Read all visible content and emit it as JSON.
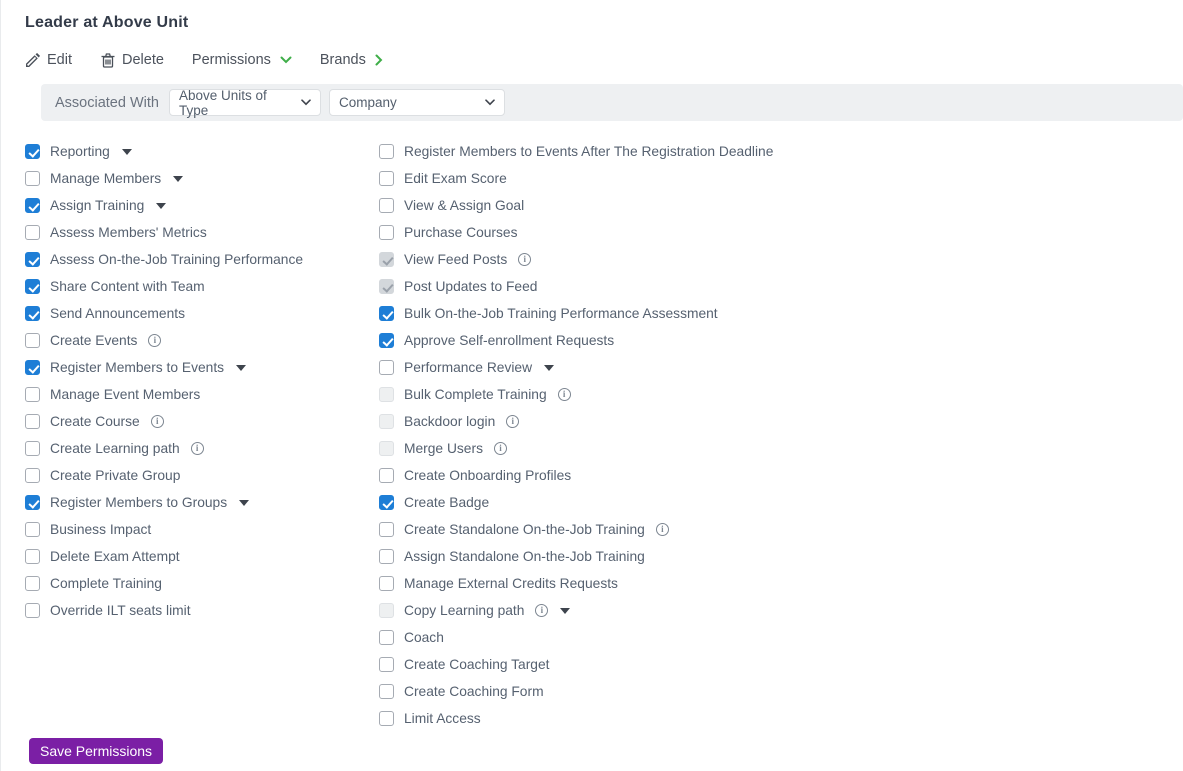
{
  "page": {
    "title": "Leader at Above Unit"
  },
  "toolbar": {
    "edit_label": "Edit",
    "delete_label": "Delete",
    "permissions_label": "Permissions",
    "brands_label": "Brands"
  },
  "filter_bar": {
    "label": "Associated With",
    "type_select_value": "Above Units of Type",
    "entity_select_value": "Company"
  },
  "colors": {
    "checkbox_checked": "#1e7ed6",
    "accent_green": "#3fae49",
    "save_button_purple": "#7b1fa5",
    "filter_bar_bg": "#eef0f2",
    "label_text": "#566170"
  },
  "permissions": {
    "left_column": [
      {
        "label": "Reporting",
        "state": "checked",
        "caret": true
      },
      {
        "label": "Manage Members",
        "state": "unchecked",
        "caret": true
      },
      {
        "label": "Assign Training",
        "state": "checked",
        "caret": true
      },
      {
        "label": "Assess Members' Metrics",
        "state": "unchecked"
      },
      {
        "label": "Assess On-the-Job Training Performance",
        "state": "checked"
      },
      {
        "label": "Share Content with Team",
        "state": "checked"
      },
      {
        "label": "Send Announcements",
        "state": "checked"
      },
      {
        "label": "Create Events",
        "state": "unchecked",
        "info": true
      },
      {
        "label": "Register Members to Events",
        "state": "checked",
        "caret": true
      },
      {
        "label": "Manage Event Members",
        "state": "unchecked"
      },
      {
        "label": "Create Course",
        "state": "unchecked",
        "info": true
      },
      {
        "label": "Create Learning path",
        "state": "unchecked",
        "info": true
      },
      {
        "label": "Create Private Group",
        "state": "unchecked"
      },
      {
        "label": "Register Members to Groups",
        "state": "checked",
        "caret": true
      },
      {
        "label": "Business Impact",
        "state": "unchecked"
      },
      {
        "label": "Delete Exam Attempt",
        "state": "unchecked"
      },
      {
        "label": "Complete Training",
        "state": "unchecked"
      },
      {
        "label": "Override ILT seats limit",
        "state": "unchecked"
      }
    ],
    "right_column": [
      {
        "label": "Register Members to Events After The Registration Deadline",
        "state": "unchecked"
      },
      {
        "label": "Edit Exam Score",
        "state": "unchecked"
      },
      {
        "label": "View & Assign Goal",
        "state": "unchecked"
      },
      {
        "label": "Purchase Courses",
        "state": "unchecked"
      },
      {
        "label": "View Feed Posts",
        "state": "checked-disabled",
        "info": true
      },
      {
        "label": "Post Updates to Feed",
        "state": "checked-disabled"
      },
      {
        "label": "Bulk On-the-Job Training Performance Assessment",
        "state": "checked"
      },
      {
        "label": "Approve Self-enrollment Requests",
        "state": "checked"
      },
      {
        "label": "Performance Review",
        "state": "unchecked",
        "caret": true
      },
      {
        "label": "Bulk Complete Training",
        "state": "unchecked-disabled",
        "info": true
      },
      {
        "label": "Backdoor login",
        "state": "unchecked-disabled",
        "info": true
      },
      {
        "label": "Merge Users",
        "state": "unchecked-disabled",
        "info": true
      },
      {
        "label": "Create Onboarding Profiles",
        "state": "unchecked"
      },
      {
        "label": "Create Badge",
        "state": "checked"
      },
      {
        "label": "Create Standalone On-the-Job Training",
        "state": "unchecked",
        "info": true
      },
      {
        "label": "Assign Standalone On-the-Job Training",
        "state": "unchecked"
      },
      {
        "label": "Manage External Credits Requests",
        "state": "unchecked"
      },
      {
        "label": "Copy Learning path",
        "state": "unchecked-disabled",
        "info": true,
        "caret": true
      },
      {
        "label": "Coach",
        "state": "unchecked"
      },
      {
        "label": "Create Coaching Target",
        "state": "unchecked"
      },
      {
        "label": "Create Coaching Form",
        "state": "unchecked"
      },
      {
        "label": "Limit Access",
        "state": "unchecked"
      }
    ]
  },
  "footer": {
    "save_button_label": "Save Permissions"
  }
}
